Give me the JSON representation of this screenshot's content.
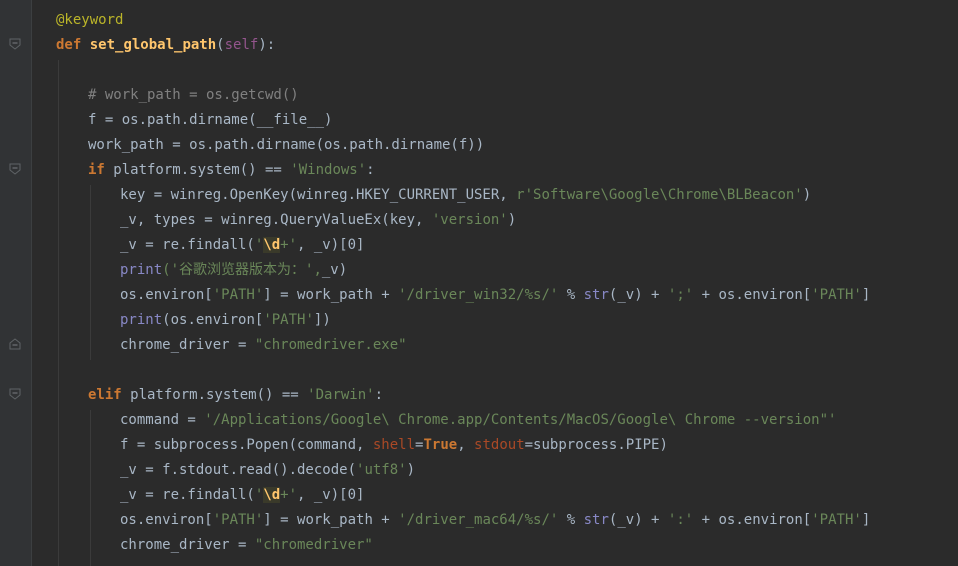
{
  "code": {
    "decorator": "@keyword",
    "def_keyword": "def",
    "func_name": "set_global_path",
    "param_self": "self",
    "comment": "# work_path = os.getcwd()",
    "lines": {
      "l4": "f = os.path.dirname(__file__)",
      "l5": "work_path = os.path.dirname(os.path.dirname(f))",
      "if_kw": "if",
      "l6_rest": " platform.system() == ",
      "windows_str": "'Windows'",
      "l7_pre": "key = winreg.OpenKey(winreg.HKEY_CURRENT_USER, ",
      "l7_str": "r'Software\\Google\\Chrome\\BLBeacon'",
      "l7_post": ")",
      "l8_pre": "_v, types = winreg.QueryValueEx(key, ",
      "l8_str": "'version'",
      "l8_post": ")",
      "l9_pre": "_v = re.findall(",
      "l9_esc": "\\d",
      "l9_str_end": "+'",
      "l9_post": ", _v)[0]",
      "print_kw": "print",
      "l10_str": "('谷歌浏览器版本为：',",
      "l10_post": "_v)",
      "l11_pre": "os.environ[",
      "path_str": "'PATH'",
      "l11_mid": "] = work_path + ",
      "l11_str": "'/driver_win32/%s/'",
      "l11_mid2": " % ",
      "str_fn": "str",
      "l11_mid3": "(_v) + ",
      "l11_sep": "';'",
      "l11_mid4": " + os.environ[",
      "l11_end": "]",
      "l12_pre": "(os.environ[",
      "l12_post": "])",
      "l13_pre": "chrome_driver = ",
      "l13_str": "\"chromedriver.exe\"",
      "elif_kw": "elif",
      "l15_rest": " platform.system() == ",
      "darwin_str": "'Darwin'",
      "colon": ":",
      "l16_pre": "command = ",
      "l16_str": "'/Applications/Google\\ Chrome.app/Contents/MacOS/Google\\ Chrome --version\"'",
      "l17_pre": "f = subprocess.Popen(command, ",
      "shell_kw": "shell",
      "eq": "=",
      "true_kw": "True",
      "comma": ", ",
      "stdout_kw": "stdout",
      "l17_post": "=subprocess.PIPE)",
      "l18_pre": "_v = f.stdout.read().decode(",
      "l18_str": "'utf8'",
      "l18_post": ")",
      "l20_str": "'/driver_mac64/%s/'",
      "l20_sep": "':'",
      "l21_str": "\"chromedriver\""
    },
    "def_tail": "):",
    "def_open": "("
  },
  "fold_icon": "fold-marker-icon"
}
